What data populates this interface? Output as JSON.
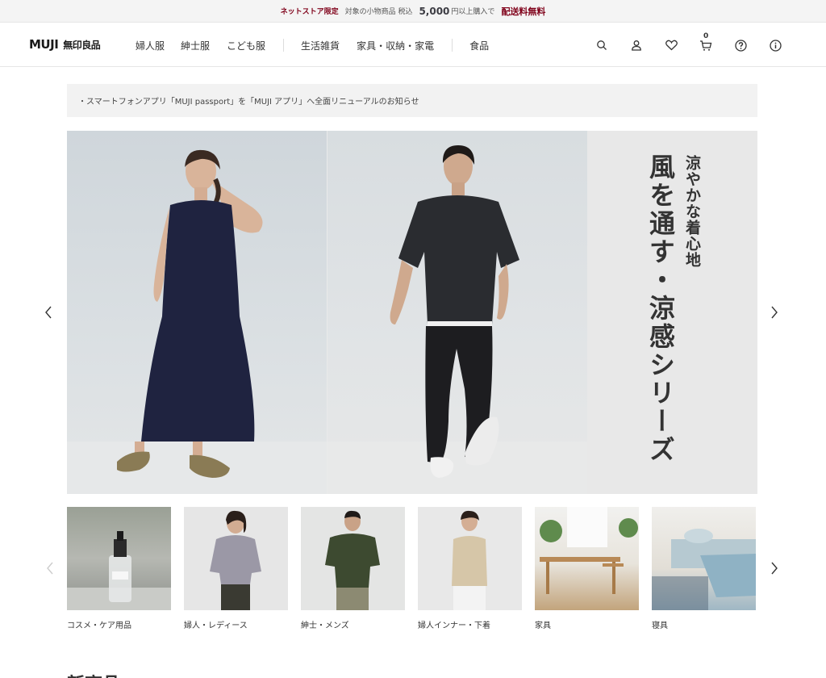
{
  "promo": {
    "tag": "ネットストア限定",
    "text_before": "対象の小物商品 税込",
    "amount": "5,000",
    "text_after": "円以上購入で",
    "free": "配送料無料"
  },
  "header": {
    "logo_en": "MUJI",
    "logo_ja": "無印良品",
    "nav": [
      "婦人服",
      "紳士服",
      "こども服",
      "生活雑貨",
      "家具・収納・家電",
      "食品"
    ],
    "cart_count": "0"
  },
  "notice": {
    "text": "・スマートフォンアプリ「MUJI passport」を「MUJI アプリ」へ全面リニューアルのお知らせ"
  },
  "hero": {
    "subtitle": "涼やかな着心地",
    "title": "風を通す・涼感シリーズ"
  },
  "categories": [
    {
      "label": "コスメ・ケア用品"
    },
    {
      "label": "婦人・レディース"
    },
    {
      "label": "紳士・メンズ"
    },
    {
      "label": "婦人インナー・下着"
    },
    {
      "label": "家具"
    },
    {
      "label": "寝具"
    }
  ],
  "section": {
    "title": "新商品"
  },
  "colors": {
    "accent": "#7f0019",
    "dress": "#1f2340",
    "shirt": "#2a2c30"
  }
}
